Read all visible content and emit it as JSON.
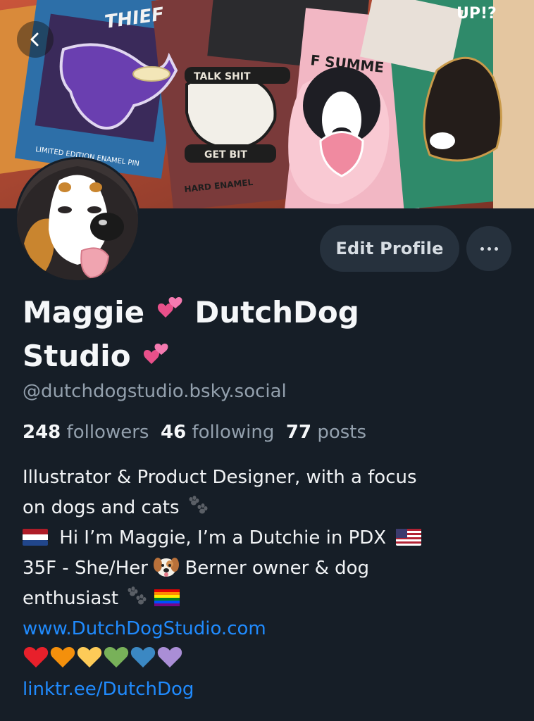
{
  "profile": {
    "name_part1": "Maggie",
    "name_part2": "DutchDog",
    "name_part3": "Studio",
    "handle": "@dutchdogstudio.bsky.social",
    "followers_count": "248",
    "followers_label": "followers",
    "following_count": "46",
    "following_label": "following",
    "posts_count": "77",
    "posts_label": "posts"
  },
  "actions": {
    "edit_profile_label": "Edit Profile",
    "more_icon": "ellipsis-icon"
  },
  "bio": {
    "line1": "Illustrator & Product Designer, with a focus",
    "line2": "on dogs and cats",
    "line3": "Hi I’m Maggie, I’m a Dutchie in PDX",
    "line4a": "35F - She/Her",
    "line4b": "Berner owner & dog",
    "line5": "enthusiast",
    "link1": "www.DutchDogStudio.com",
    "link2": "linktr.ee/DutchDog"
  },
  "icons": {
    "back": "chevron-left-icon",
    "name_emoji": "two-hearts-icon",
    "paws": "paw-prints-icon",
    "flag_nl": "netherlands-flag-icon",
    "flag_us": "usa-flag-icon",
    "dog": "dog-face-icon",
    "rainbow": "rainbow-flag-icon",
    "hearts": [
      "red-heart-icon",
      "orange-heart-icon",
      "yellow-heart-icon",
      "green-heart-icon",
      "blue-heart-icon",
      "purple-heart-icon"
    ]
  },
  "colors": {
    "background": "#161e27",
    "button_bg": "#26313d",
    "link": "#208bfe",
    "muted_text": "#93a0ad",
    "heart_red": "#e8202b",
    "heart_orange": "#f4900c",
    "heart_yellow": "#fdcb58",
    "heart_green": "#78b159",
    "heart_blue": "#3b88c3",
    "heart_purple": "#aa8ed6"
  }
}
